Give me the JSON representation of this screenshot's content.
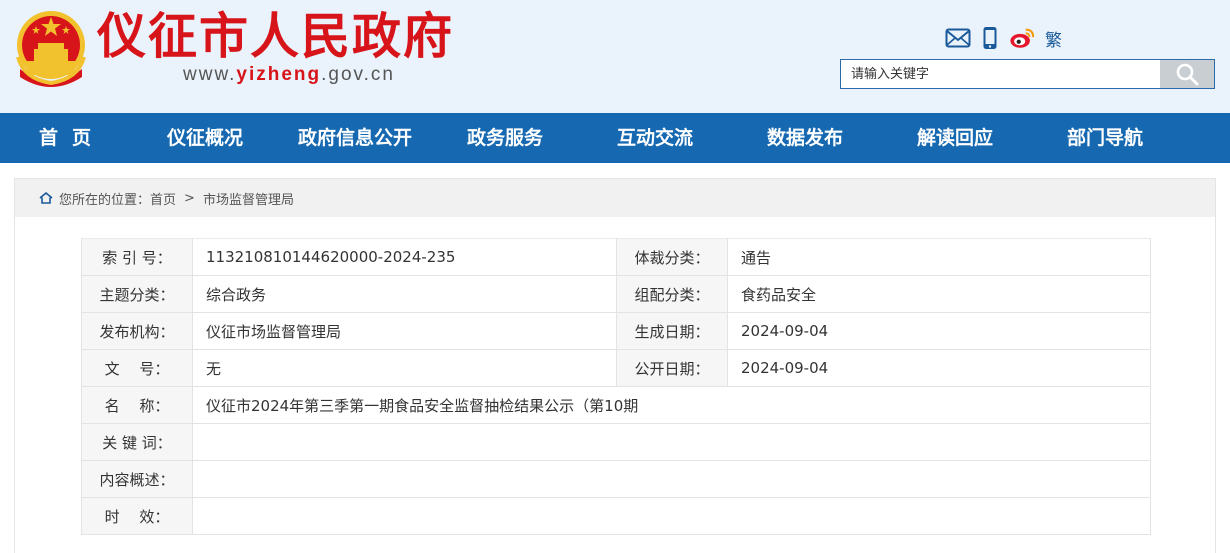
{
  "header": {
    "site_title": "仪征市人民政府",
    "url_prefix": "www.",
    "url_highlight": "yizheng",
    "url_suffix": ".gov.cn",
    "traditional_label": "繁",
    "search_placeholder": "请输入关键字"
  },
  "colors": {
    "brand_red": "#d8141b",
    "nav_blue": "#1668b1",
    "header_bg": "#eaf3fb"
  },
  "icons": [
    "mail-icon",
    "mobile-icon",
    "weibo-icon",
    "search-icon",
    "home-icon"
  ],
  "nav": {
    "items": [
      "首页",
      "仪征概况",
      "政府信息公开",
      "政务服务",
      "互动交流",
      "数据发布",
      "解读回应",
      "部门导航"
    ]
  },
  "breadcrumb": {
    "prefix": "您所在的位置：",
    "home": "首页",
    "separator": ">",
    "current": "市场监督管理局"
  },
  "info": {
    "index_label": "索 引 号：",
    "index_value": "113210810144620000-2024-235",
    "genre_label": "体裁分类：",
    "genre_value": "通告",
    "topic_label": "主题分类：",
    "topic_value": "综合政务",
    "group_label": "组配分类：",
    "group_value": "食药品安全",
    "publisher_label": "发布机构：",
    "publisher_value": "仪征市场监督管理局",
    "created_label": "生成日期：",
    "created_value": "2024-09-04",
    "docno_label": "文　 号：",
    "docno_value": "无",
    "public_label": "公开日期：",
    "public_value": "2024-09-04",
    "name_label": "名　 称：",
    "name_value": "仪征市2024年第三季第一期食品安全监督抽检结果公示（第10期",
    "keywords_label": "关 键 词：",
    "keywords_value": "",
    "summary_label": "内容概述：",
    "summary_value": "",
    "validity_label": "时　 效：",
    "validity_value": ""
  }
}
